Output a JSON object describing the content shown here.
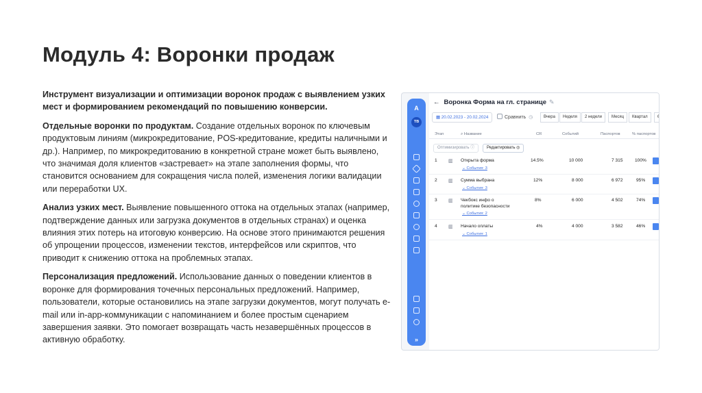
{
  "title": "Модуль 4: Воронки продаж",
  "intro": "Инструмент визуализации и оптимизации воронок продаж с выявлением узких мест и формированием рекомендаций по повышению конверсии.",
  "paragraphs": [
    {
      "heading": "Отдельные воронки по продуктам.",
      "text": " Создание отдельных воронок по ключевым продуктовым линиям (микрокредитование, POS-кредитование, кредиты наличными и др.). Например, по микрокредитованию в конкретной стране может быть выявлено, что значимая доля клиентов «застревает» на этапе заполнения формы, что становится основанием для сокращения числа полей, изменения логики валидации или переработки UX."
    },
    {
      "heading": "Анализ узких мест.",
      "text": " Выявление повышенного оттока на отдельных этапах (например, подтверждение данных или загрузка документов в отдельных странах) и оценка влияния этих потерь на итоговую конверсию. На основе этого принимаются решения об упрощении процессов, изменении текстов, интерфейсов или скриптов, что приводит к снижению оттока на проблемных этапах."
    },
    {
      "heading": "Персонализация предложений.",
      "text": " Использование данных о поведении клиентов в воронке для формирования точечных персональных предложений. Например, пользователи, которые остановились на этапе загрузки документов, могут получать e-mail или in-app-коммуникации с напоминанием и более простым сценарием завершения заявки. Это помогает возвращать часть незавершённых процессов в активную обработку."
    }
  ],
  "screenshot": {
    "rail": {
      "logo": "A",
      "avatar": "TB",
      "more": "»"
    },
    "header": {
      "back": "←",
      "title": "Воронка Форма на гл. странице",
      "edit_icon": "✎"
    },
    "date_range": "20.02.2023 - 20.02.2024",
    "compare_label": "Сравнить",
    "periods": [
      "Вчера",
      "Неделя",
      "2 недели",
      "Месяц",
      "Квартал",
      "6"
    ],
    "columns": [
      "Этап",
      "Название",
      "CR",
      "Событий",
      "Паспортов",
      "% паспортов"
    ],
    "optimize_label": "Оптимизировать",
    "edit_label": "Редактировать",
    "rows": [
      {
        "stage": "1",
        "name": "Открыта форма",
        "events_link": "События: 3",
        "cr": "14.5%",
        "events": "10 000",
        "passports": "7 315",
        "pct": "100%"
      },
      {
        "stage": "2",
        "name": "Сумма выбрана",
        "events_link": "События: 3",
        "cr": "12%",
        "events": "8 000",
        "passports": "6 972",
        "pct": "95%"
      },
      {
        "stage": "3",
        "name": "Чекбокс инфо о",
        "name2": "политике безопасности",
        "events_link": "События: 2",
        "cr": "8%",
        "events": "6 000",
        "passports": "4 502",
        "pct": "74%"
      },
      {
        "stage": "4",
        "name": "Начало оплаты",
        "events_link": "События: 1",
        "cr": "4%",
        "events": "4 000",
        "passports": "3 582",
        "pct": "46%"
      }
    ],
    "accent_color": "#4a86f0"
  }
}
